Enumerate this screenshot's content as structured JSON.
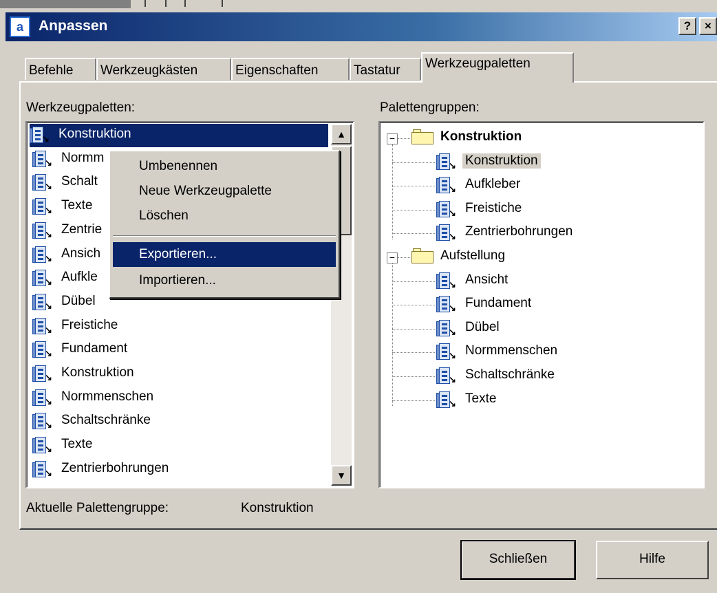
{
  "window": {
    "title": "Anpassen",
    "help_button": "?",
    "close_button": "×"
  },
  "tabs": [
    {
      "label": "Befehle"
    },
    {
      "label": "Werkzeugkästen"
    },
    {
      "label": "Eigenschaften"
    },
    {
      "label": "Tastatur"
    },
    {
      "label": "Werkzeugpaletten",
      "active": true
    }
  ],
  "left": {
    "label": "Werkzeugpaletten:",
    "items": [
      "Konstruktion",
      "Normm",
      "Schalt",
      "Texte",
      "Zentrie",
      "Ansich",
      "Aufkle",
      "Dübel",
      "Freistiche",
      "Fundament",
      "Konstruktion",
      "Normmenschen",
      "Schaltschränke",
      "Texte",
      "Zentrierbohrungen"
    ],
    "selected_index": 0
  },
  "context_menu": {
    "items": [
      "Umbenennen",
      "Neue Werkzeugpalette",
      "Löschen",
      "Exportieren...",
      "Importieren..."
    ],
    "highlighted": "Exportieren..."
  },
  "right": {
    "label": "Palettengruppen:",
    "groups": [
      {
        "name": "Konstruktion",
        "bold": true,
        "expander": "−",
        "children": [
          "Konstruktion",
          "Aufkleber",
          "Freistiche",
          "Zentrierbohrungen"
        ]
      },
      {
        "name": "Aufstellung",
        "bold": false,
        "expander": "−",
        "children": [
          "Ansicht",
          "Fundament",
          "Dübel",
          "Normmenschen",
          "Schaltschränke",
          "Texte"
        ]
      }
    ],
    "selected_child": "Konstruktion"
  },
  "current_group": {
    "label": "Aktuelle Palettengruppe:",
    "value": "Konstruktion"
  },
  "buttons": {
    "close": "Schließen",
    "help": "Hilfe"
  },
  "colors": {
    "selection": "#0a246a",
    "face": "#d4d0c8",
    "title_start": "#0a246a",
    "title_end": "#a6caf0"
  },
  "icons": {
    "app": "customize-app-icon",
    "palette": "tool-palette-icon",
    "folder": "folder-icon"
  }
}
